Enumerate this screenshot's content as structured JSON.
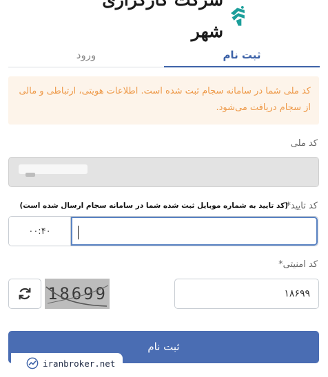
{
  "brand": {
    "name": "شرکت کارگزاری شهر",
    "logo_icon": "shahr-logo-mark",
    "color": "#1b9e9a"
  },
  "tabs": [
    {
      "label": "ثبت نام",
      "active": true
    },
    {
      "label": "ورود",
      "active": false
    }
  ],
  "notice": {
    "line1": "کد ملی شما در سامانه سجام ثبت شده است. اطلاعات هویتی، ارتباطی و مالی",
    "line2": "از سجام دریافت می‌شود."
  },
  "form": {
    "national_id": {
      "label": "کد ملی",
      "value": ""
    },
    "verification": {
      "label": "کد تایید",
      "required_mark": "*",
      "hint": "(کد تایید به شماره موبایل ثبت شده شما در سامانه سجام ارسال شده است)",
      "timer": "۰۰:۴۰",
      "value": ""
    },
    "captcha": {
      "label": "کد امنیتی",
      "required_mark": "*",
      "value": "۱۸۶۹۹",
      "image_text": "18699",
      "refresh_icon": "refresh-icon"
    },
    "submit_label": "ثبت نام"
  },
  "watermark": {
    "text": "iranbroker.net",
    "icon": "chart-logo-icon"
  },
  "colors": {
    "accent": "#4a6db3",
    "notice_bg": "#fdf4ea",
    "notice_text": "#ee9a4a"
  }
}
